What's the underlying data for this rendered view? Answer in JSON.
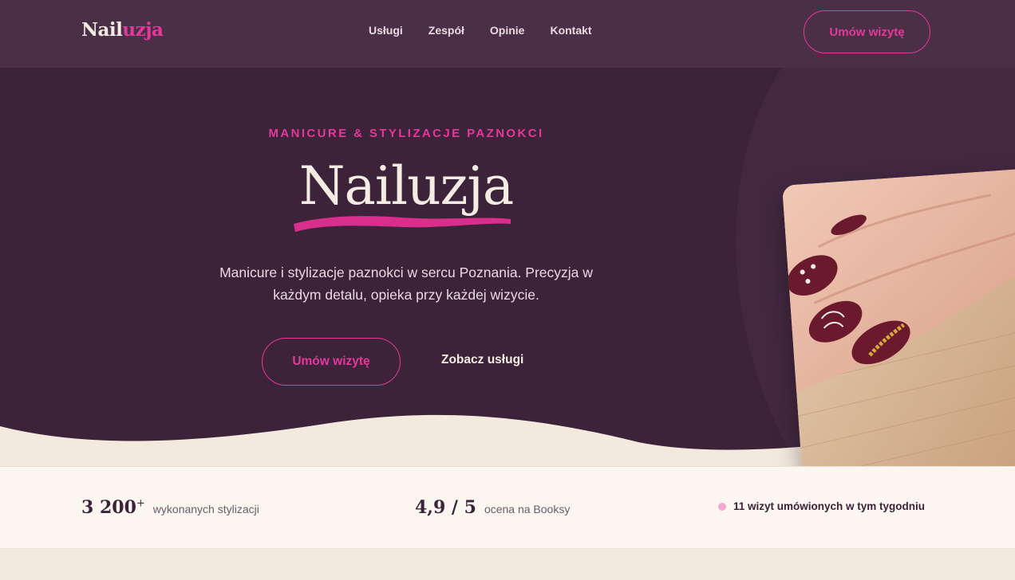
{
  "brand": {
    "name_main": "Nail",
    "name_accent": "uzja"
  },
  "nav": {
    "items": [
      {
        "label": "Usługi"
      },
      {
        "label": "Zespół"
      },
      {
        "label": "Opinie"
      },
      {
        "label": "Kontakt"
      }
    ],
    "cta_label": "Umów wizytę"
  },
  "hero": {
    "eyebrow": "MANICURE & STYLIZACJE PAZNOKCI",
    "title": "Nailuzja",
    "subtitle": "Manicure i stylizacje paznokci w sercu Poznania. Precyzja w każdym detalu, opieka przy każdej wizycie.",
    "primary_cta": "Umów wizytę",
    "secondary_cta": "Zobacz usługi"
  },
  "stats": {
    "done_value": "3 200",
    "done_suffix": "+",
    "done_label": "wykonanych stylizacji",
    "rating_value": "4,9 / 5",
    "rating_label": "ocena na Booksy",
    "live_text": "11 wizyt umówionych w tym tygodniu"
  },
  "colors": {
    "accent": "#e4389a",
    "header_bg": "#4a2f46",
    "hero_bg": "#3c2339",
    "cream": "#f3e9df"
  }
}
